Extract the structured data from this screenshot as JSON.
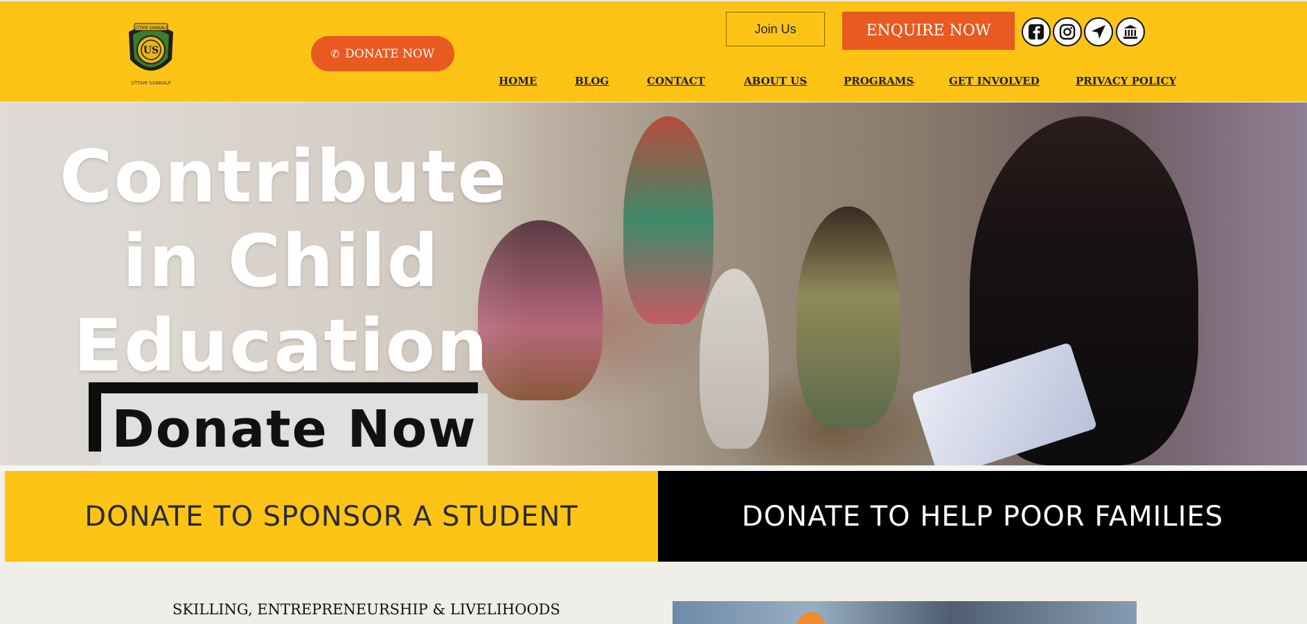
{
  "header": {
    "logo_text_top": "UTTAM SANKALP",
    "logo_text_bottom": "UTTAM SANKALP",
    "logo_monogram": "US",
    "donate_button": "DONATE NOW",
    "join_button": "Join Us",
    "enquire_button": "ENQUIRE NOW",
    "social_icons": [
      "facebook-icon",
      "instagram-icon",
      "location-arrow-icon",
      "bank-icon"
    ],
    "nav": [
      {
        "label": "HOME"
      },
      {
        "label": "BLOG"
      },
      {
        "label": "CONTACT"
      },
      {
        "label": "ABOUT US",
        "has_dropdown": true
      },
      {
        "label": "PROGRAMS",
        "has_dropdown": true
      },
      {
        "label": "GET INVOLVED"
      },
      {
        "label": "PRIVACY POLICY"
      }
    ]
  },
  "hero": {
    "title_lines": [
      "Contribute",
      "in Child",
      "Education"
    ],
    "cta": "Donate Now",
    "slides": 3,
    "active_slide": 1
  },
  "cta_bands": {
    "left": "DONATE TO SPONSOR A STUDENT",
    "right": "DONATE TO HELP POOR FAMILIES"
  },
  "section": {
    "title": "SKILLING, ENTREPRENEURSHIP & LIVELIHOODS"
  },
  "colors": {
    "brand_yellow": "#fdc416",
    "accent_orange": "#e95a20",
    "black": "#000000"
  }
}
